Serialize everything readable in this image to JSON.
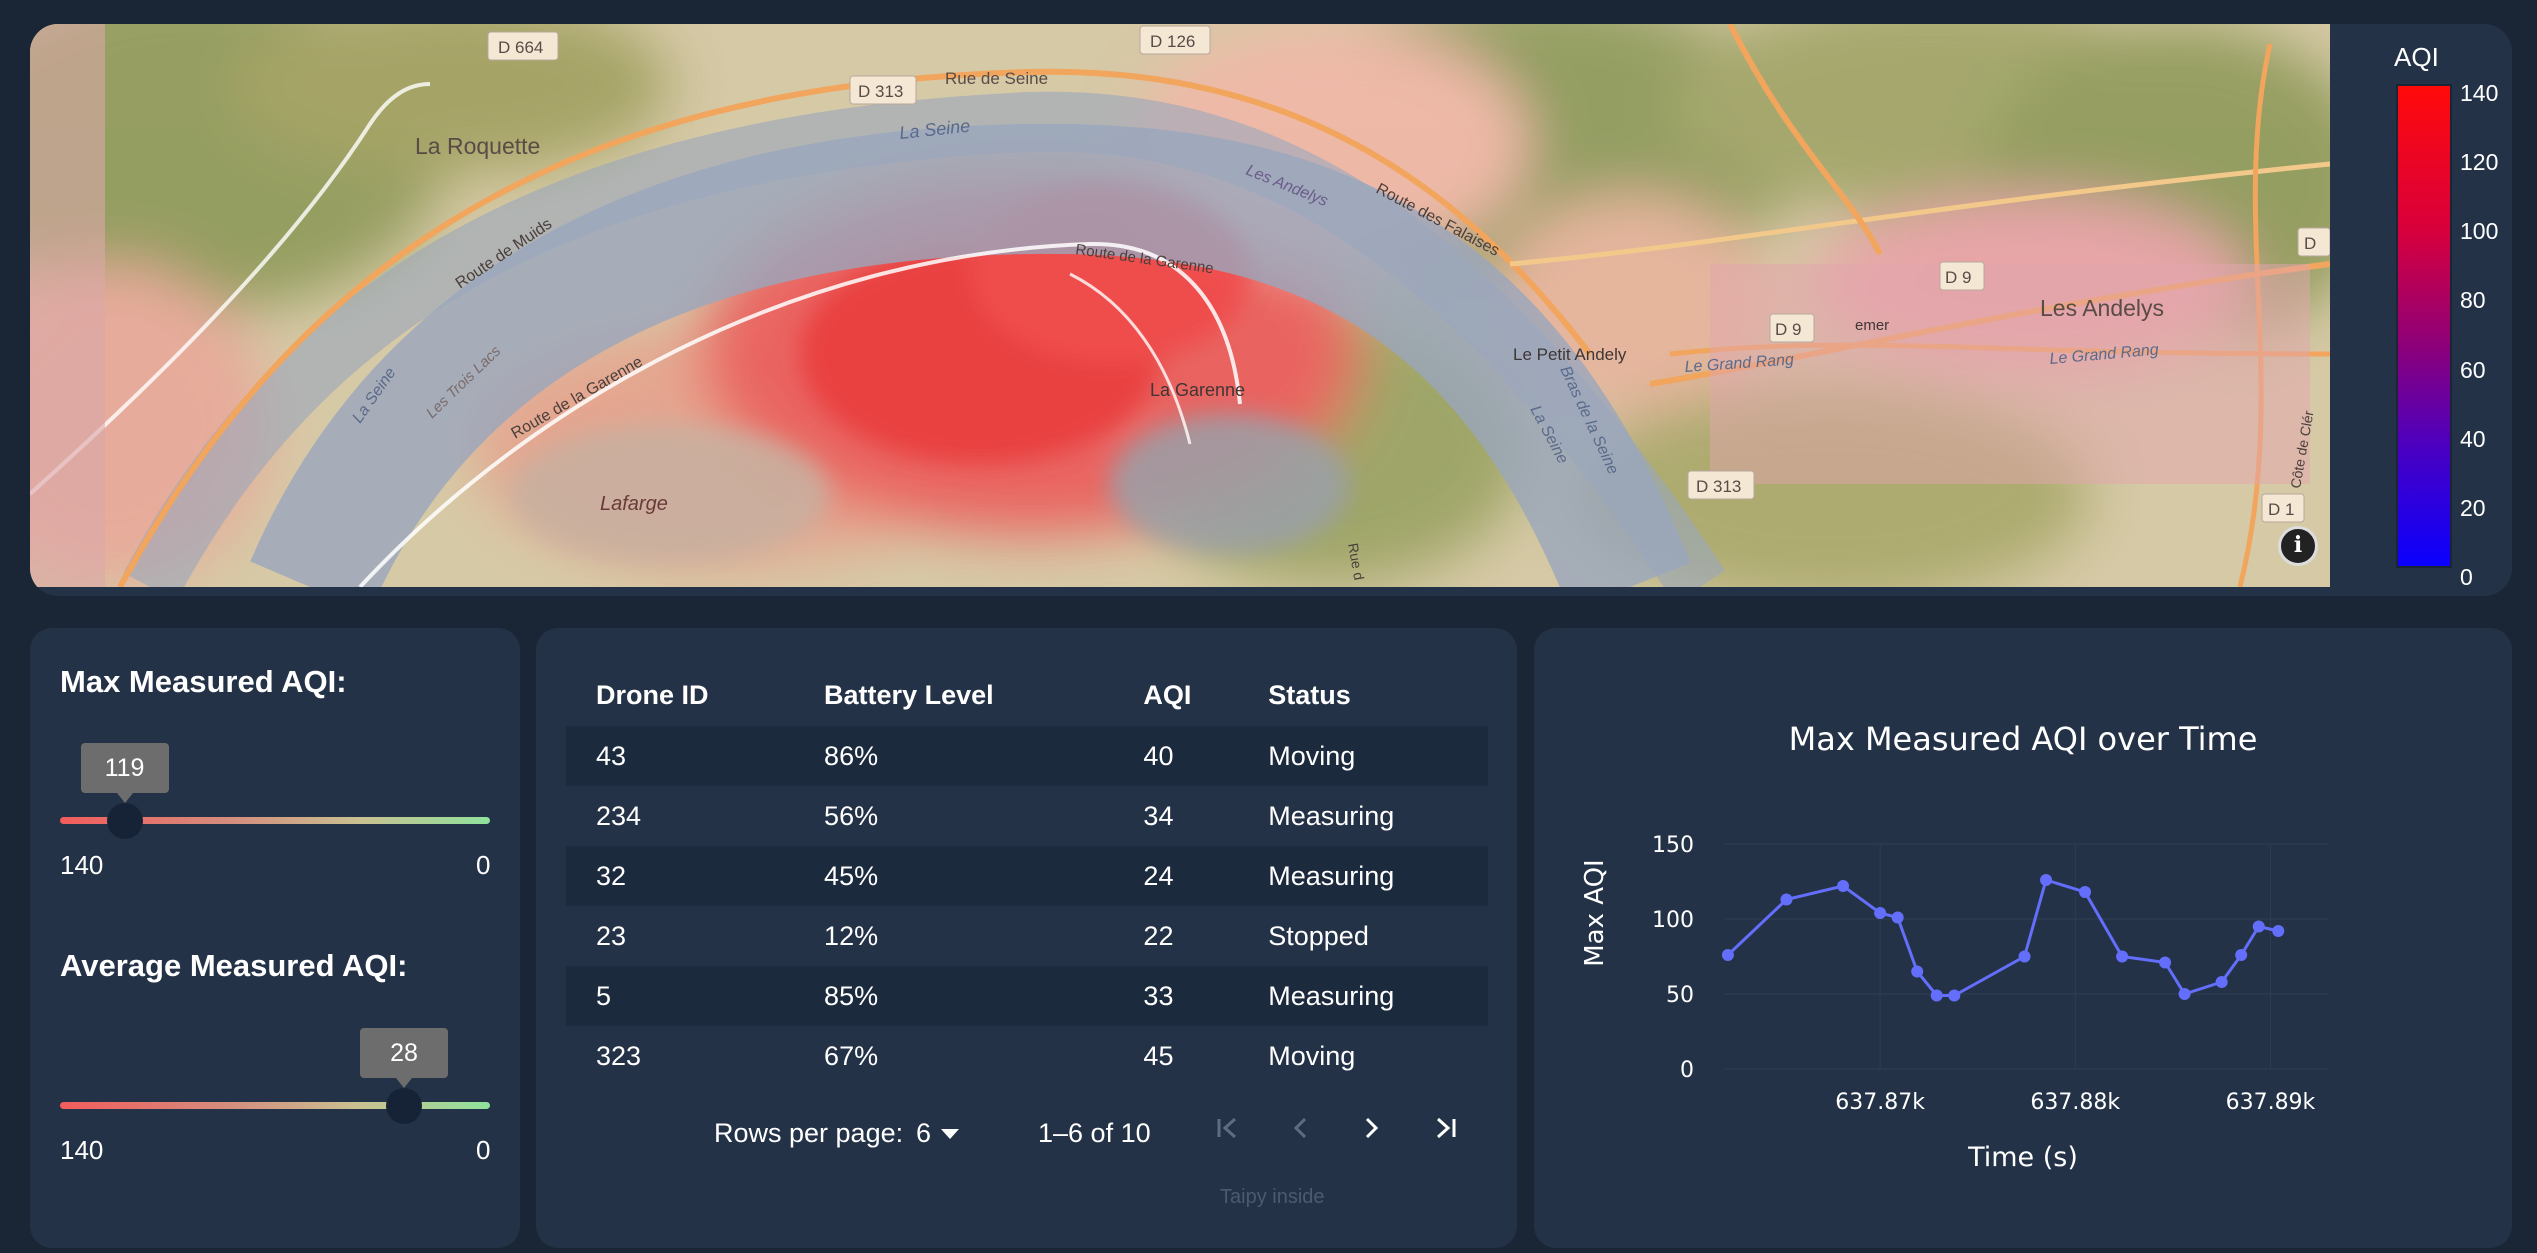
{
  "map": {
    "places": [
      "La Roquette",
      "Rue de Seine",
      "La Seine",
      "Les Andelys",
      "Route des Falaises",
      "Route de Muids",
      "Les Trois Lacs",
      "La Seine",
      "Route de la Garenne",
      "Route de la Garenne",
      "La Garenne",
      "Lafarge",
      "Le Petit Andely",
      "Bras de la Seine",
      "La Seine",
      "Les Andelys",
      "Le Grand Rang",
      "Le Grand Rang",
      "emer",
      "Côte de Clér",
      "Rue d"
    ],
    "roads": [
      "D 664",
      "D 126",
      "D 313",
      "D 9",
      "D 9",
      "D 313",
      "D 1",
      "D"
    ],
    "info_icon": "info-icon"
  },
  "legend": {
    "title": "AQI",
    "ticks": [
      "140",
      "120",
      "100",
      "80",
      "60",
      "40",
      "20",
      "0"
    ],
    "colors": [
      "#0a00ff",
      "#ff0a0a"
    ]
  },
  "gauges": {
    "max": {
      "title": "Max Measured AQI:",
      "value": "119",
      "min_label": "140",
      "max_label": "0",
      "fraction": 0.15
    },
    "avg": {
      "title": "Average Measured AQI:",
      "value": "28",
      "min_label": "140",
      "max_label": "0",
      "fraction": 0.8
    }
  },
  "table": {
    "headers": [
      "Drone ID",
      "Battery Level",
      "AQI",
      "Status"
    ],
    "rows": [
      [
        "43",
        "86%",
        "40",
        "Moving"
      ],
      [
        "234",
        "56%",
        "34",
        "Measuring"
      ],
      [
        "32",
        "45%",
        "24",
        "Measuring"
      ],
      [
        "23",
        "12%",
        "22",
        "Stopped"
      ],
      [
        "5",
        "85%",
        "33",
        "Measuring"
      ],
      [
        "323",
        "67%",
        "45",
        "Moving"
      ]
    ],
    "rows_per_page_label": "Rows per page:",
    "rows_per_page": "6",
    "range": "1–6 of 10",
    "footer": "Taipy inside"
  },
  "chart_data": {
    "type": "line",
    "title": "Max Measured AQI over Time",
    "xlabel": "Time (s)",
    "ylabel": "Max AQI",
    "x_ticks": [
      "637.87k",
      "637.88k",
      "637.89k"
    ],
    "y_ticks": [
      "0",
      "50",
      "100",
      "150"
    ],
    "xlim": [
      637862,
      637893
    ],
    "ylim": [
      0,
      150
    ],
    "color": "#636efa",
    "x": [
      637862.2,
      637865.2,
      637868.1,
      637870.0,
      637870.9,
      637871.9,
      637872.9,
      637873.8,
      637877.4,
      637878.5,
      637880.5,
      637882.4,
      637884.6,
      637885.6,
      637887.5,
      637888.5,
      637889.4,
      637890.4
    ],
    "y": [
      76,
      113,
      122,
      104,
      101,
      65,
      49,
      49,
      75,
      126,
      118,
      75,
      71,
      50,
      58,
      76,
      95,
      92
    ]
  }
}
